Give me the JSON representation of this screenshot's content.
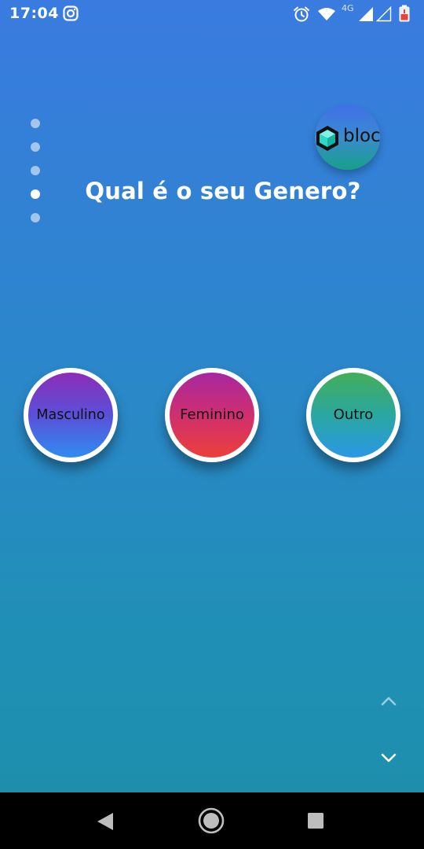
{
  "status_bar": {
    "time": "17:04",
    "network_label": "4G",
    "icons": [
      "instagram-icon",
      "alarm-icon",
      "wifi-icon",
      "signal-icon",
      "signal-empty-icon",
      "battery-low-icon"
    ]
  },
  "page_indicator": {
    "total": 5,
    "active_index": 3
  },
  "logo": {
    "text": "bloc",
    "icon": "cube-icon"
  },
  "question": {
    "title": "Qual é o seu Genero?"
  },
  "options": [
    {
      "label": "Masculino",
      "colors": [
        "#8c2db8",
        "#2f8cf0"
      ]
    },
    {
      "label": "Feminino",
      "colors": [
        "#a8279f",
        "#ec403a"
      ]
    },
    {
      "label": "Outro",
      "colors": [
        "#43ae5a",
        "#2a98e6"
      ]
    }
  ],
  "navigation": {
    "up_icon": "chevron-up-icon",
    "down_icon": "chevron-down-icon"
  },
  "system_nav": {
    "back_icon": "back-triangle-icon",
    "home_icon": "home-circle-icon",
    "recents_icon": "recents-square-icon"
  },
  "colors": {
    "background_top": "#3a7be0",
    "background_bottom": "#1c8fa8",
    "text": "#ffffff"
  }
}
